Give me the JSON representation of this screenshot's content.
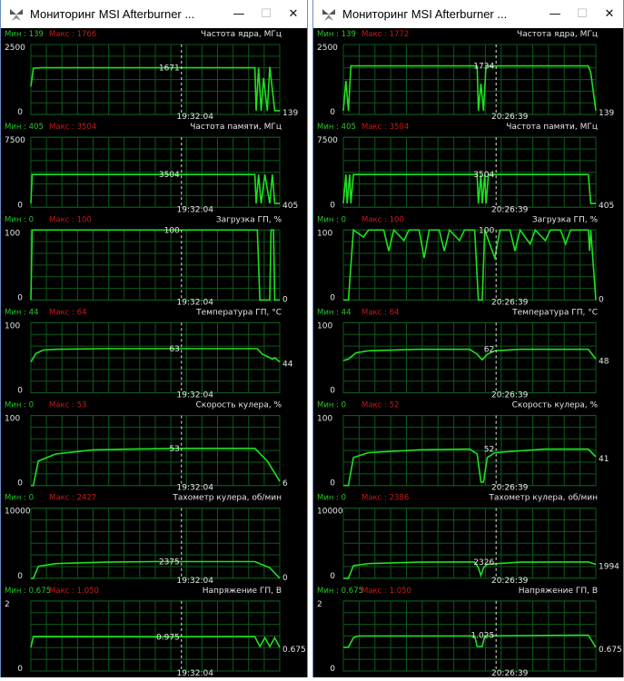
{
  "colors": {
    "background": "#000000",
    "grid": "#0d5a1a",
    "line": "#1fe01f",
    "min_text": "#29c629",
    "max_text": "#c81919",
    "label": "#e6e6e6",
    "marker": "#e6e6e6",
    "window_border": "#6a8cbf"
  },
  "windows": [
    {
      "title": "Мониторинг MSI Afterburner ...",
      "time": "19:32:04",
      "icons": {
        "app": "afterburner-icon",
        "min": "minimize-icon",
        "max": "maximize-icon",
        "close": "close-icon"
      },
      "panels": [
        {
          "name": "Частота ядра, МГц",
          "min_label": "Мин : 139",
          "max_label": "Макс : 1766",
          "ymax": "2500",
          "ymin": "0",
          "ymax_val": 2500,
          "value": "1671",
          "value_y": 1671,
          "last": "139",
          "last_y": 139,
          "series": [
            [
              0,
              1000
            ],
            [
              0.01,
              1650
            ],
            [
              0.04,
              1671
            ],
            [
              0.5,
              1671
            ],
            [
              0.9,
              1671
            ],
            [
              0.905,
              139
            ],
            [
              0.915,
              1671
            ],
            [
              0.925,
              139
            ],
            [
              0.935,
              1300
            ],
            [
              0.95,
              139
            ],
            [
              0.96,
              1700
            ],
            [
              0.97,
              900
            ],
            [
              0.98,
              139
            ],
            [
              1.0,
              139
            ]
          ]
        },
        {
          "name": "Частота памяти, МГц",
          "min_label": "Мин : 405",
          "max_label": "Макс : 3504",
          "ymax": "7500",
          "ymin": "0",
          "ymax_val": 7500,
          "value": "3504",
          "value_y": 3504,
          "last": "405",
          "last_y": 405,
          "series": [
            [
              0,
              405
            ],
            [
              0.005,
              3504
            ],
            [
              0.5,
              3504
            ],
            [
              0.9,
              3504
            ],
            [
              0.905,
              405
            ],
            [
              0.915,
              3504
            ],
            [
              0.925,
              405
            ],
            [
              0.94,
              3504
            ],
            [
              0.96,
              405
            ],
            [
              0.97,
              3504
            ],
            [
              0.98,
              405
            ],
            [
              1.0,
              405
            ]
          ]
        },
        {
          "name": "Загрузка ГП, %",
          "min_label": "Мин : 0",
          "max_label": "Макс : 100",
          "ymax": "100",
          "ymin": "0",
          "ymax_val": 100,
          "value": "100",
          "value_y": 100,
          "last": "0",
          "last_y": 0,
          "series": [
            [
              0,
              0
            ],
            [
              0.005,
              100
            ],
            [
              0.5,
              100
            ],
            [
              0.91,
              100
            ],
            [
              0.92,
              0
            ],
            [
              0.96,
              0
            ],
            [
              0.965,
              100
            ],
            [
              0.975,
              100
            ],
            [
              0.98,
              0
            ],
            [
              1.0,
              0
            ]
          ]
        },
        {
          "name": "Температура ГП, °С",
          "min_label": "Мин : 44",
          "max_label": "Макс : 64",
          "ymax": "100",
          "ymin": "0",
          "ymax_val": 100,
          "value": "63",
          "value_y": 63,
          "last": "44",
          "last_y": 44,
          "series": [
            [
              0,
              44
            ],
            [
              0.02,
              56
            ],
            [
              0.05,
              61
            ],
            [
              0.1,
              62
            ],
            [
              0.3,
              63
            ],
            [
              0.6,
              63
            ],
            [
              0.91,
              63
            ],
            [
              0.93,
              55
            ],
            [
              0.95,
              52
            ],
            [
              0.97,
              48
            ],
            [
              0.98,
              50
            ],
            [
              1.0,
              44
            ]
          ]
        },
        {
          "name": "Скорость кулера, %",
          "min_label": "Мин : 0",
          "max_label": "Макс : 53",
          "ymax": "100",
          "ymin": "0",
          "ymax_val": 100,
          "value": "53",
          "value_y": 53,
          "last": "6",
          "last_y": 6,
          "series": [
            [
              0,
              0
            ],
            [
              0.01,
              0
            ],
            [
              0.03,
              35
            ],
            [
              0.1,
              45
            ],
            [
              0.25,
              51
            ],
            [
              0.4,
              52
            ],
            [
              0.6,
              53
            ],
            [
              0.9,
              53
            ],
            [
              0.95,
              35
            ],
            [
              1.0,
              6
            ]
          ]
        },
        {
          "name": "Тахометр кулера, об/мин",
          "min_label": "Мин : 0",
          "max_label": "Макс : 2427",
          "ymax": "10000",
          "ymin": "0",
          "ymax_val": 10000,
          "value": "2375",
          "value_y": 2375,
          "last": "0",
          "last_y": 0,
          "series": [
            [
              0,
              0
            ],
            [
              0.01,
              0
            ],
            [
              0.03,
              1700
            ],
            [
              0.1,
              2100
            ],
            [
              0.3,
              2300
            ],
            [
              0.5,
              2375
            ],
            [
              0.9,
              2375
            ],
            [
              0.96,
              1500
            ],
            [
              1.0,
              0
            ]
          ]
        },
        {
          "name": "Напряжение ГП, В",
          "min_label": "Мин : 0.675",
          "max_label": "Макс : 1.050",
          "ymax": "2",
          "ymin": "0",
          "ymax_val": 2,
          "value": "0.975",
          "value_y": 0.975,
          "last": "0.675",
          "last_y": 0.675,
          "series": [
            [
              0,
              0.675
            ],
            [
              0.01,
              0.98
            ],
            [
              0.5,
              0.975
            ],
            [
              0.9,
              0.98
            ],
            [
              0.92,
              0.7
            ],
            [
              0.94,
              0.95
            ],
            [
              0.96,
              0.7
            ],
            [
              0.98,
              0.95
            ],
            [
              1.0,
              0.675
            ]
          ]
        }
      ]
    },
    {
      "title": "Мониторинг MSI Afterburner ...",
      "time": "20:26:39",
      "icons": {
        "app": "afterburner-icon",
        "min": "minimize-icon",
        "max": "maximize-icon",
        "close": "close-icon"
      },
      "panels": [
        {
          "name": "Частота ядра, МГц",
          "min_label": "Мин : 139",
          "max_label": "Макс : 1772",
          "ymax": "2500",
          "ymin": "0",
          "ymax_val": 2500,
          "value": "1734",
          "value_y": 1734,
          "last": "139",
          "last_y": 139,
          "series": [
            [
              0,
              139
            ],
            [
              0.01,
              1200
            ],
            [
              0.02,
              139
            ],
            [
              0.03,
              1734
            ],
            [
              0.5,
              1734
            ],
            [
              0.53,
              1734
            ],
            [
              0.535,
              139
            ],
            [
              0.545,
              1100
            ],
            [
              0.555,
              139
            ],
            [
              0.565,
              1734
            ],
            [
              0.9,
              1734
            ],
            [
              0.97,
              1734
            ],
            [
              0.98,
              1500
            ],
            [
              1.0,
              139
            ]
          ]
        },
        {
          "name": "Частота памяти, МГц",
          "min_label": "Мин : 405",
          "max_label": "Макс : 3504",
          "ymax": "7500",
          "ymin": "0",
          "ymax_val": 7500,
          "value": "3504",
          "value_y": 3504,
          "last": "405",
          "last_y": 405,
          "series": [
            [
              0,
              405
            ],
            [
              0.01,
              3504
            ],
            [
              0.015,
              405
            ],
            [
              0.025,
              3504
            ],
            [
              0.03,
              405
            ],
            [
              0.04,
              3504
            ],
            [
              0.53,
              3504
            ],
            [
              0.535,
              405
            ],
            [
              0.545,
              3504
            ],
            [
              0.55,
              405
            ],
            [
              0.56,
              3504
            ],
            [
              0.565,
              405
            ],
            [
              0.575,
              3504
            ],
            [
              0.97,
              3504
            ],
            [
              0.98,
              405
            ],
            [
              1.0,
              405
            ]
          ]
        },
        {
          "name": "Загрузка ГП, %",
          "min_label": "Мин : 0",
          "max_label": "Макс : 100",
          "ymax": "100",
          "ymin": "0",
          "ymax_val": 100,
          "value": "100",
          "value_y": 100,
          "last": "0",
          "last_y": 0,
          "series": [
            [
              0,
              0
            ],
            [
              0.02,
              0
            ],
            [
              0.04,
              100
            ],
            [
              0.08,
              90
            ],
            [
              0.1,
              100
            ],
            [
              0.16,
              100
            ],
            [
              0.18,
              70
            ],
            [
              0.2,
              100
            ],
            [
              0.24,
              85
            ],
            [
              0.26,
              100
            ],
            [
              0.3,
              100
            ],
            [
              0.32,
              60
            ],
            [
              0.34,
              100
            ],
            [
              0.38,
              100
            ],
            [
              0.4,
              70
            ],
            [
              0.42,
              100
            ],
            [
              0.46,
              85
            ],
            [
              0.48,
              100
            ],
            [
              0.52,
              100
            ],
            [
              0.535,
              0
            ],
            [
              0.55,
              0
            ],
            [
              0.56,
              100
            ],
            [
              0.6,
              60
            ],
            [
              0.62,
              100
            ],
            [
              0.66,
              100
            ],
            [
              0.68,
              70
            ],
            [
              0.7,
              100
            ],
            [
              0.74,
              80
            ],
            [
              0.76,
              100
            ],
            [
              0.8,
              85
            ],
            [
              0.82,
              100
            ],
            [
              0.86,
              100
            ],
            [
              0.88,
              80
            ],
            [
              0.9,
              100
            ],
            [
              0.97,
              100
            ],
            [
              0.975,
              70
            ],
            [
              0.98,
              100
            ],
            [
              1.0,
              0
            ]
          ]
        },
        {
          "name": "Температура ГП, °С",
          "min_label": "Мин : 44",
          "max_label": "Макс : 64",
          "ymax": "100",
          "ymin": "0",
          "ymax_val": 100,
          "value": "62",
          "value_y": 62,
          "last": "48",
          "last_y": 48,
          "series": [
            [
              0,
              46
            ],
            [
              0.02,
              48
            ],
            [
              0.05,
              57
            ],
            [
              0.1,
              60
            ],
            [
              0.3,
              62
            ],
            [
              0.5,
              62
            ],
            [
              0.53,
              55
            ],
            [
              0.55,
              47
            ],
            [
              0.57,
              55
            ],
            [
              0.6,
              60
            ],
            [
              0.7,
              62
            ],
            [
              0.97,
              62
            ],
            [
              1.0,
              48
            ]
          ]
        },
        {
          "name": "Скорость кулера, %",
          "min_label": "Мин : 0",
          "max_label": "Макс : 52",
          "ymax": "100",
          "ymin": "0",
          "ymax_val": 100,
          "value": "52",
          "value_y": 52,
          "last": "41",
          "last_y": 41,
          "series": [
            [
              0,
              0
            ],
            [
              0.02,
              0
            ],
            [
              0.04,
              40
            ],
            [
              0.1,
              47
            ],
            [
              0.3,
              51
            ],
            [
              0.5,
              52
            ],
            [
              0.53,
              45
            ],
            [
              0.545,
              5
            ],
            [
              0.555,
              5
            ],
            [
              0.57,
              40
            ],
            [
              0.6,
              47
            ],
            [
              0.8,
              52
            ],
            [
              0.97,
              52
            ],
            [
              1.0,
              41
            ]
          ]
        },
        {
          "name": "Тахометр кулера, об/мин",
          "min_label": "Мин : 0",
          "max_label": "Макс : 2386",
          "ymax": "10000",
          "ymin": "0",
          "ymax_val": 10000,
          "value": "2326",
          "value_y": 2326,
          "last": "1994",
          "last_y": 1994,
          "series": [
            [
              0,
              0
            ],
            [
              0.02,
              0
            ],
            [
              0.04,
              1800
            ],
            [
              0.1,
              2100
            ],
            [
              0.3,
              2300
            ],
            [
              0.52,
              2326
            ],
            [
              0.535,
              1500
            ],
            [
              0.545,
              400
            ],
            [
              0.555,
              1500
            ],
            [
              0.57,
              2000
            ],
            [
              0.7,
              2300
            ],
            [
              0.97,
              2326
            ],
            [
              1.0,
              1994
            ]
          ]
        },
        {
          "name": "Напряжение ГП, В",
          "min_label": "Мин : 0.675",
          "max_label": "Макс : 1.050",
          "ymax": "2",
          "ymin": "0",
          "ymax_val": 2,
          "value": "1.025",
          "value_y": 1.025,
          "last": "0.675",
          "last_y": 0.675,
          "series": [
            [
              0,
              0.675
            ],
            [
              0.02,
              0.68
            ],
            [
              0.04,
              0.95
            ],
            [
              0.06,
              1.0
            ],
            [
              0.3,
              1.0
            ],
            [
              0.52,
              1.0
            ],
            [
              0.53,
              0.7
            ],
            [
              0.55,
              0.7
            ],
            [
              0.56,
              1.0
            ],
            [
              0.97,
              1.025
            ],
            [
              1.0,
              0.675
            ]
          ]
        }
      ]
    }
  ]
}
